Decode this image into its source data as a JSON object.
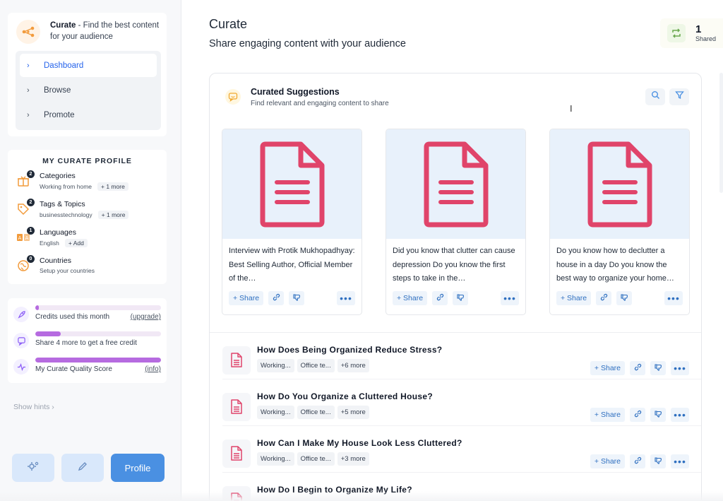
{
  "brand": {
    "name": "Curate",
    "tagline": "- Find the best content for your audience"
  },
  "nav": [
    {
      "label": "Dashboard",
      "active": true
    },
    {
      "label": "Browse",
      "active": false
    },
    {
      "label": "Promote",
      "active": false
    }
  ],
  "profile": {
    "title": "MY CURATE PROFILE",
    "rows": [
      {
        "icon": "box-icon",
        "badge": "2",
        "label": "Categories",
        "sub": "Working from home",
        "chip": "+ 1 more"
      },
      {
        "icon": "tag-icon",
        "badge": "2",
        "label": "Tags & Topics",
        "sub": "businesstechnology",
        "chip": "+ 1 more"
      },
      {
        "icon": "translate-icon",
        "badge": "1",
        "label": "Languages",
        "sub": "English",
        "chip": "+ Add"
      },
      {
        "icon": "globe-icon",
        "badge": "0",
        "label": "Countries",
        "sub": "Setup your countries",
        "chip": ""
      }
    ]
  },
  "credits": [
    {
      "label": "Credits used this month",
      "link": "(upgrade)",
      "progress": 0.03
    },
    {
      "label": "Share 4 more to get a free credit",
      "link": "",
      "progress": 0.2
    },
    {
      "label": "My Curate Quality Score",
      "link": "(info)",
      "progress": 1.0
    }
  ],
  "hints": "Show hints",
  "profile_button": "Profile",
  "header": {
    "title": "Curate",
    "subtitle": "Share engaging content with your audience"
  },
  "shared": {
    "count": "1",
    "label": "Shared"
  },
  "panel": {
    "title": "Curated Suggestions",
    "subtitle": "Find relevant and engaging content to share"
  },
  "share_label": "+ Share",
  "suggestions": [
    {
      "text": "Interview with Protik Mukhopadhyay: Best Selling Author, Official Member of the…"
    },
    {
      "text": "Did you know that clutter can cause depression Do you know the first steps to take in the…"
    },
    {
      "text": "Do you know how to declutter a house in a day Do you know the best way to organize your home…"
    }
  ],
  "list": [
    {
      "title": "How Does Being Organized Reduce Stress?",
      "tags": [
        "Working...",
        "Office te...",
        "+6 more"
      ]
    },
    {
      "title": "How Do You Organize a Cluttered House?",
      "tags": [
        "Working...",
        "Office te...",
        "+5 more"
      ]
    },
    {
      "title": "How Can I Make My House Look Less Cluttered?",
      "tags": [
        "Working...",
        "Office te...",
        "+3 more"
      ]
    },
    {
      "title": "How Do I Begin to Organize My Life?",
      "tags": []
    }
  ],
  "colors": {
    "accent": "#4a90e2",
    "doc": "#e0446a",
    "progress": "#b66be0"
  }
}
